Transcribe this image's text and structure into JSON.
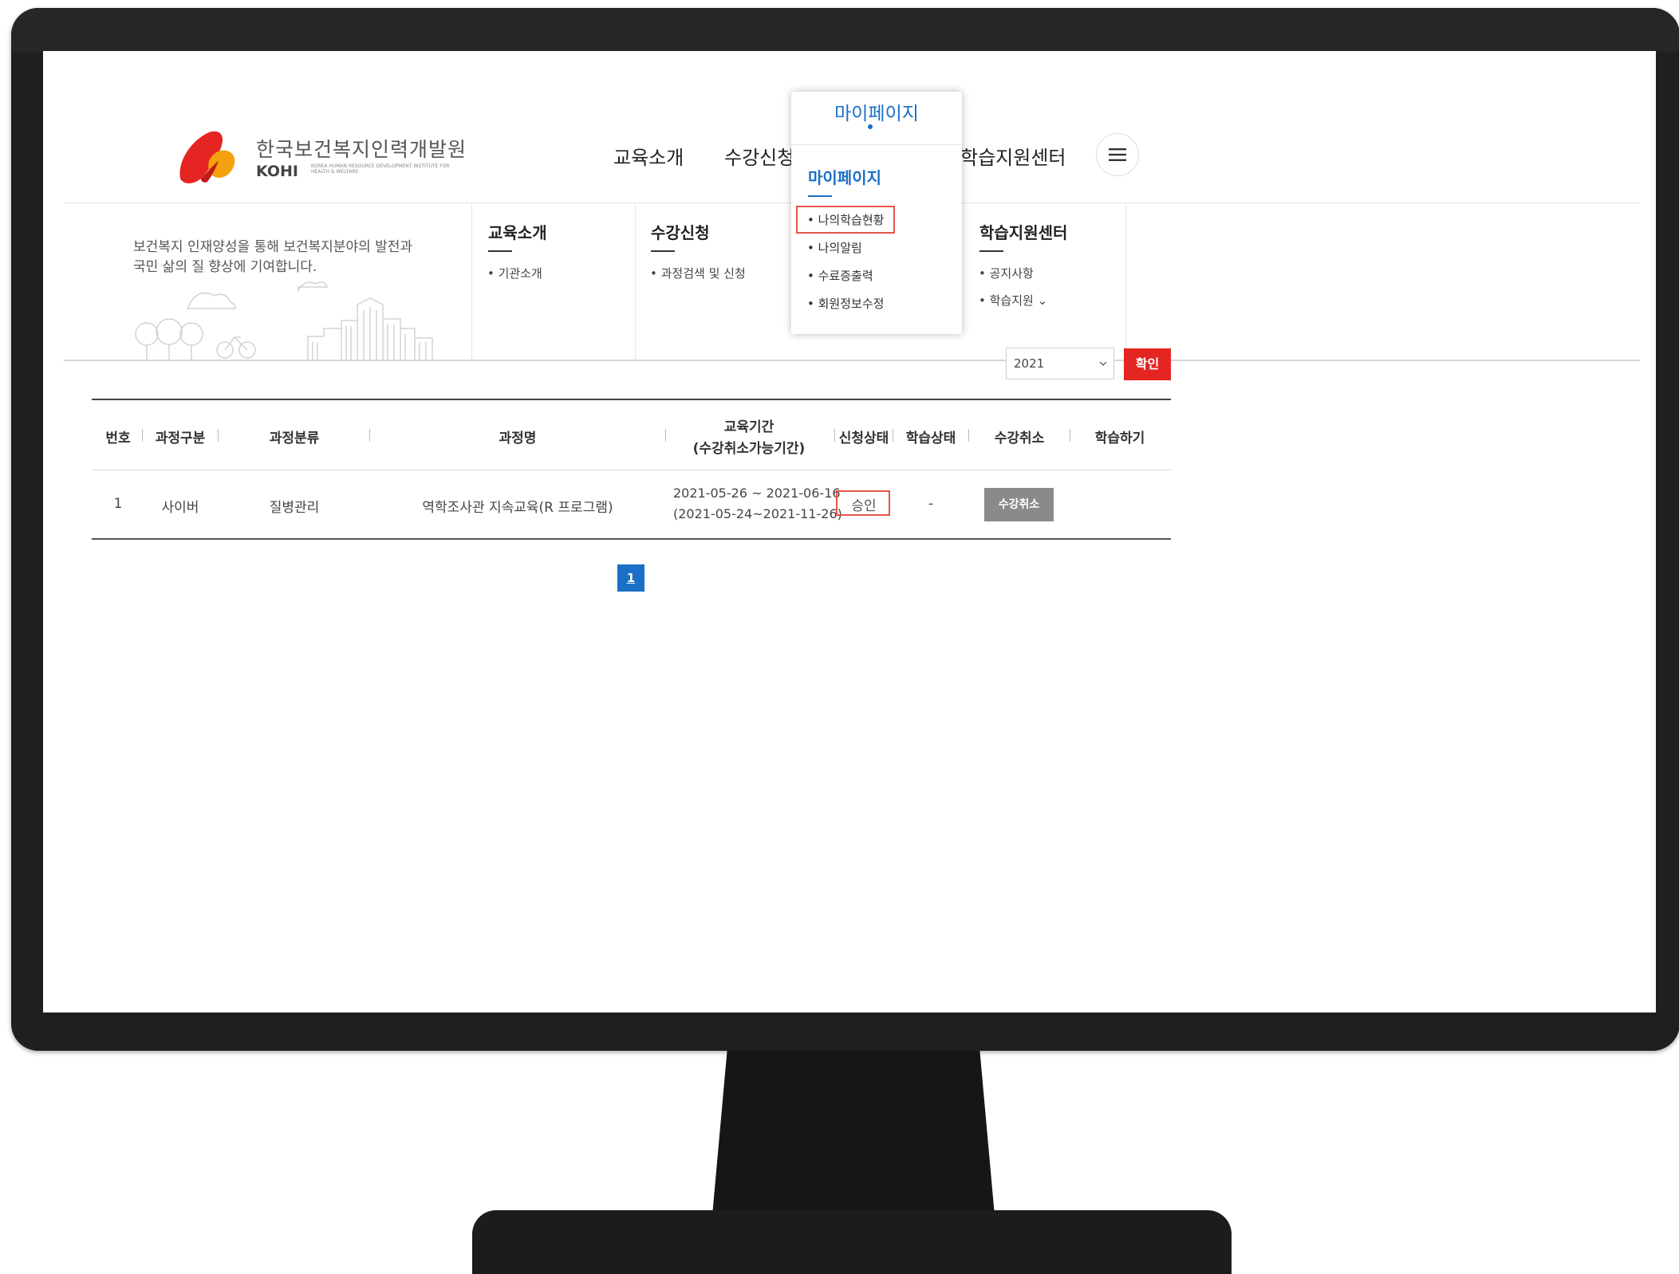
{
  "header": {
    "logo_ko": "한국보건복지인력개발원",
    "logo_en": "KOHI",
    "logo_sub": "KOREA HUMAN RESOURCE DEVELOPMENT INSTITUTE FOR HEALTH & WELFARE",
    "nav": [
      "교육소개",
      "수강신청",
      "마이페이지",
      "학습지원센터"
    ],
    "menu_icon": "hamburger-menu-icon"
  },
  "mega_menu": {
    "slogan": [
      "보건복지 인재양성을 통해 보건복지분야의 발전과",
      "국민 삶의 질 향상에 기여합니다."
    ],
    "columns": [
      {
        "title": "교육소개",
        "links": [
          "• 기관소개"
        ]
      },
      {
        "title": "수강신청",
        "links": [
          "• 과정검색 및 신청"
        ]
      },
      {
        "title": "마이페이지",
        "links": [
          "• 나의학습현황",
          "• 나의알림",
          "• 수료증출력",
          "• 회원정보수정"
        ]
      },
      {
        "title": "학습지원센터",
        "links": [
          "• 공지사항",
          "• 학습지원 ⌄"
        ]
      }
    ]
  },
  "filter": {
    "year": "2021",
    "confirm_label": "확인"
  },
  "table": {
    "headers": [
      "번호",
      "과정구분",
      "과정분류",
      "과정명",
      "교육기간",
      "(수강취소가능기간)",
      "신청상태",
      "학습상태",
      "수강취소",
      "학습하기"
    ],
    "rows": [
      {
        "no": "1",
        "type": "사이버",
        "category": "질병관리",
        "name": "역학조사관 지속교육(R 프로그램)",
        "period": "2021-05-26 ~ 2021-06-16",
        "cancel_period": "(2021-05-24~2021-11-26)",
        "status": "승인",
        "learning_status": "-",
        "cancel_label": "수강취소"
      }
    ]
  },
  "pagination": {
    "current": "1"
  },
  "colors": {
    "accent_blue": "#1a6fc7",
    "confirm_red": "#e52521",
    "highlight_red": "#e4554c"
  }
}
